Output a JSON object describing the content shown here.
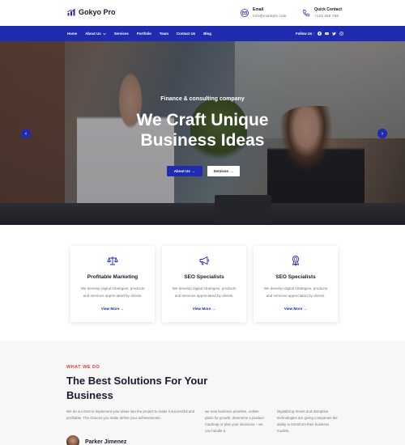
{
  "colors": {
    "brand_blue": "#1f2bb0",
    "accent_red": "#e63b2e",
    "dark_text": "#1a1a2e"
  },
  "header": {
    "logo_text": "Gokyo Pro",
    "logo_icon": "bar-chart-icon",
    "email": {
      "title": "Email",
      "value": "info@example.com",
      "icon": "envelope-icon"
    },
    "phone": {
      "title": "Quick Contact",
      "value": "+123 456 789",
      "icon": "phone-icon"
    }
  },
  "nav": {
    "links": [
      "Home",
      "About Us",
      "Services",
      "Portfolio",
      "Team",
      "Contact Us",
      "Blog"
    ],
    "follow_label": "Follow Us :",
    "social_icons": [
      "facebook-icon",
      "youtube-icon",
      "twitter-icon",
      "instagram-icon"
    ]
  },
  "hero": {
    "kicker": "Finance & consulting company",
    "title_line1": "We Craft Unique",
    "title_line2": "Business Ideas",
    "primary_button": "About Us",
    "secondary_button": "Services"
  },
  "features": [
    {
      "icon": "scales-icon",
      "title": "Profitable Marketing",
      "text": "We develop digital strategies, products and services appreciated by clients.",
      "link": "View More"
    },
    {
      "icon": "megaphone-icon",
      "title": "SEO Specialists",
      "text": "We develop digital strategies, products and services appreciated by clients.",
      "link": "View More"
    },
    {
      "icon": "award-icon",
      "title": "SEO Specialists",
      "text": "We develop digital strategies, products and services appreciated by clients.",
      "link": "View More"
    }
  ],
  "solutions": {
    "kicker": "WHAT WE DO",
    "title": "The Best Solutions For Your Business",
    "col1": "We do our best to implement your ideas into the project to make it successful and profitable. The choices you make define your achievements.",
    "col2": "we new business priorities, outline plans for growth, determine a product roadmap or plan your decisions – we can handle it.",
    "col3": "Digitalizing trends and disruptive technologies are giving companies the ability to transform their business models.",
    "author_name": "Parker Jimenez"
  }
}
